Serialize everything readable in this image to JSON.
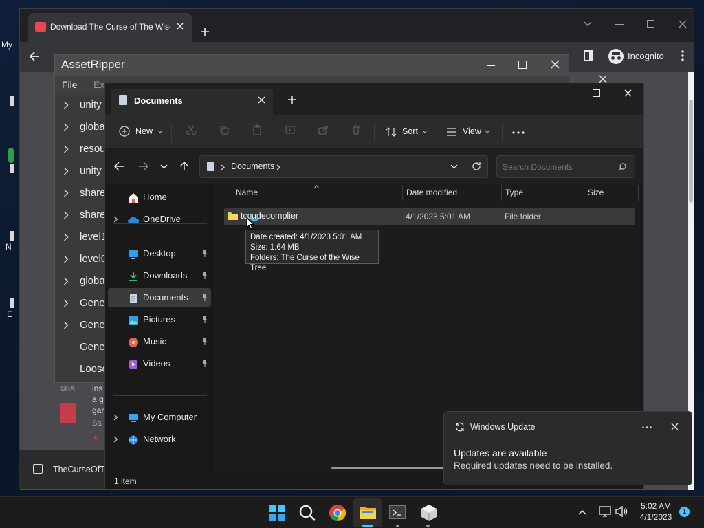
{
  "desktop": {
    "labels": [
      "My",
      "N",
      "E"
    ]
  },
  "chrome": {
    "tab_title": "Download The Curse of The Wise",
    "profile_label": "Incognito",
    "bottom_item": "TheCurseOfT"
  },
  "asset_ripper": {
    "title": "AssetRipper",
    "menu": [
      "File",
      "Ex"
    ],
    "items": [
      {
        "label": "unity",
        "chevron": true
      },
      {
        "label": "globa",
        "chevron": true
      },
      {
        "label": "resou",
        "chevron": true
      },
      {
        "label": "unity",
        "chevron": true
      },
      {
        "label": "share",
        "chevron": true
      },
      {
        "label": "share",
        "chevron": true
      },
      {
        "label": "level1",
        "chevron": true
      },
      {
        "label": "level0",
        "chevron": true
      },
      {
        "label": "globa",
        "chevron": true
      },
      {
        "label": "Gener",
        "chevron": true
      },
      {
        "label": "Gener",
        "chevron": true
      },
      {
        "label": "Gener",
        "chevron": false
      },
      {
        "label": "Loose",
        "chevron": false
      }
    ],
    "partial_text": [
      "SHA",
      "ins",
      "a g",
      "gar",
      "Sa"
    ]
  },
  "explorer": {
    "tab_title": "Documents",
    "commands": {
      "new": "New",
      "sort": "Sort",
      "view": "View"
    },
    "address": "Documents",
    "search_placeholder": "Search Documents",
    "sidebar": {
      "top": [
        {
          "label": "Home",
          "icon": "home-icon"
        },
        {
          "label": "OneDrive",
          "icon": "cloud-icon"
        }
      ],
      "quick": [
        {
          "label": "Desktop",
          "icon": "desktop-icon"
        },
        {
          "label": "Downloads",
          "icon": "download-icon"
        },
        {
          "label": "Documents",
          "icon": "document-icon"
        },
        {
          "label": "Pictures",
          "icon": "pictures-icon"
        },
        {
          "label": "Music",
          "icon": "music-icon"
        },
        {
          "label": "Videos",
          "icon": "video-icon"
        }
      ],
      "bottom": [
        {
          "label": "My Computer",
          "icon": "computer-icon"
        },
        {
          "label": "Network",
          "icon": "network-icon"
        }
      ]
    },
    "columns": [
      "Name",
      "Date modified",
      "Type",
      "Size"
    ],
    "rows": [
      {
        "name": "tccudecomplier",
        "date": "4/1/2023 5:01 AM",
        "type": "File folder",
        "size": ""
      }
    ],
    "tooltip": {
      "line1": "Date created: 4/1/2023 5:01 AM",
      "line2": "Size: 1.64 MB",
      "line3": "Folders: The Curse of the Wise Tree"
    },
    "status": "1 item"
  },
  "toast": {
    "app": "Windows Update",
    "title": "Updates are available",
    "body": "Required updates need to be installed."
  },
  "taskbar": {
    "time": "5:02 AM",
    "date": "4/1/2023",
    "notification_count": "1"
  },
  "colors": {
    "accent": "#4cc2ff",
    "selection": "#3a3a3a",
    "folder": "#f2c744"
  }
}
